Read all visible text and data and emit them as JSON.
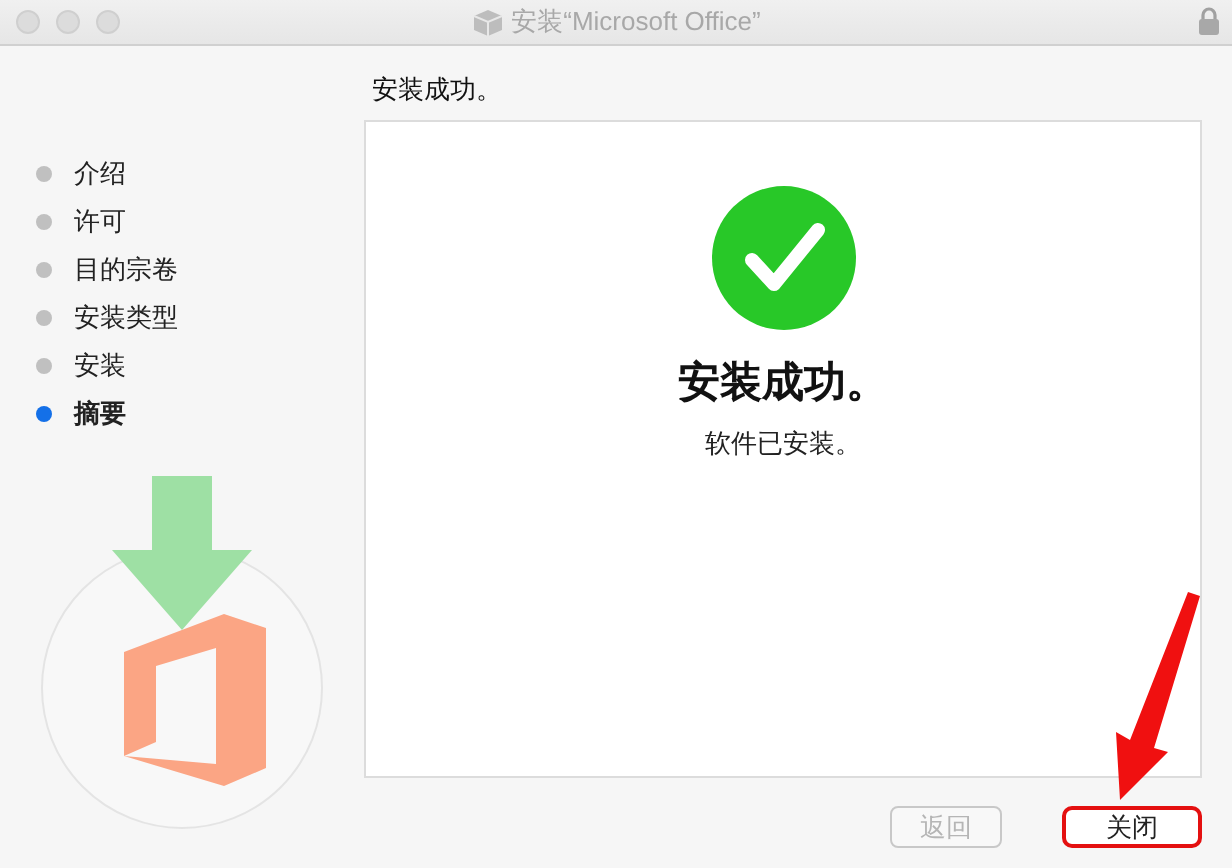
{
  "window": {
    "title": "安装“Microsoft Office”"
  },
  "sidebar": {
    "items": [
      {
        "label": "介绍",
        "selected": false
      },
      {
        "label": "许可",
        "selected": false
      },
      {
        "label": "目的宗卷",
        "selected": false
      },
      {
        "label": "安装类型",
        "selected": false
      },
      {
        "label": "安装",
        "selected": false
      },
      {
        "label": "摘要",
        "selected": true
      }
    ]
  },
  "header": "安装成功。",
  "panel": {
    "title": "安装成功。",
    "message": "软件已安装。"
  },
  "buttons": [
    {
      "label": "返回",
      "disabled": true
    },
    {
      "label": "关闭",
      "disabled": false
    }
  ]
}
